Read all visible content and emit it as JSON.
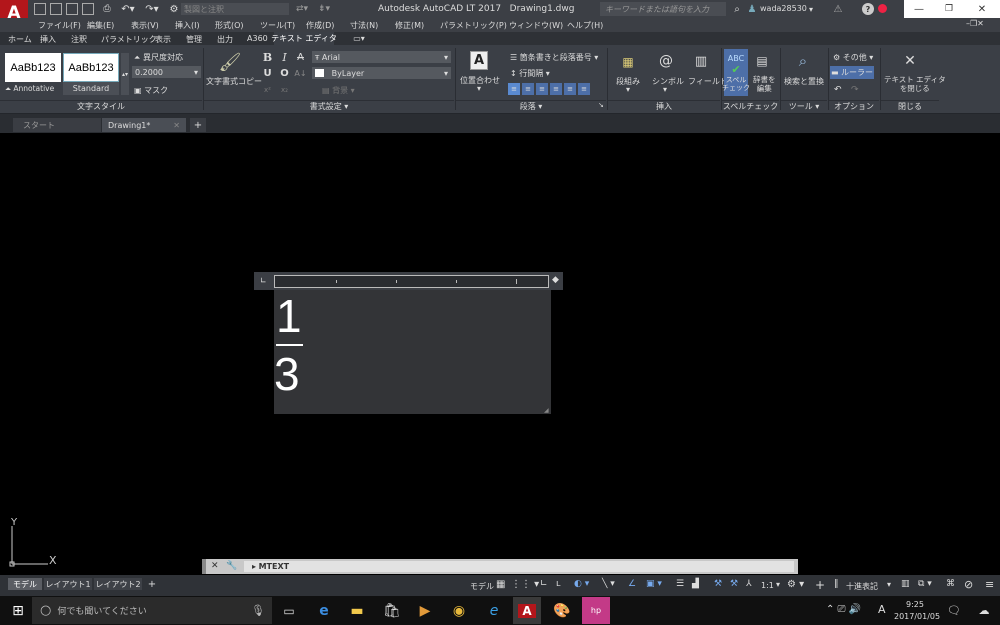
{
  "app": {
    "title": "Autodesk AutoCAD LT 2017",
    "file": "Drawing1.dwg",
    "logo": "A",
    "logo_sub": "LT",
    "search_placeholder": "キーワードまたは語句を入力",
    "user": "wada28530"
  },
  "quick_access": {
    "workspace": "製図と注釈"
  },
  "menu": [
    "ファイル(F)",
    "編集(E)",
    "表示(V)",
    "挿入(I)",
    "形式(O)",
    "ツール(T)",
    "作成(D)",
    "寸法(N)",
    "修正(M)",
    "パラメトリック(P)",
    "ウィンドウ(W)",
    "ヘルプ(H)"
  ],
  "ribbon_tabs": [
    "ホーム",
    "挿入",
    "注釈",
    "パラメトリック",
    "表示",
    "管理",
    "出力",
    "A360",
    "テキスト エディタ"
  ],
  "ribbon": {
    "style_sample": "AaBb123",
    "style1": "Annotative",
    "style2": "Standard",
    "annotative": "異尺度対応",
    "height": "0.2000",
    "mask": "マスク",
    "match": "文字書式コピー",
    "bold": "B",
    "italic": "I",
    "strike": "A",
    "underline": "U",
    "overline": "O",
    "font": "Arial",
    "color": "ByLayer",
    "bg_mask": "背景",
    "justify": "位置合わせ",
    "bullets": "箇条書きと段落番号",
    "line_spacing": "行間隔",
    "columns": "段組み",
    "symbol": "シンボル",
    "field": "フィールド",
    "spell": "スペル\nチェック",
    "dict": "辞書を\n編集",
    "find": "検索と置換",
    "more": "その他",
    "ruler": "ルーラー",
    "close": "テキスト エディタ\nを閉じる",
    "groups": [
      "文字スタイル",
      "書式設定 ▾",
      "段落 ▾",
      "挿入",
      "スペルチェック ↘",
      "ツール ▾",
      "オプション",
      "閉じる"
    ]
  },
  "doc_tabs": {
    "start": "スタート",
    "drawing": "Drawing1*"
  },
  "mtext": {
    "numerator": "1",
    "denominator": "3"
  },
  "ucs": {
    "x": "X",
    "y": "Y"
  },
  "command": {
    "value": "MTEXT"
  },
  "layout_tabs": [
    "モデル",
    "レイアウト1",
    "レイアウト2"
  ],
  "status": {
    "model": "モデル",
    "scale": "1:1",
    "units": "十進表記"
  },
  "taskbar": {
    "search_placeholder": "何でも聞いてください",
    "time": "9:25",
    "date": "2017/01/05",
    "ime": "A"
  }
}
